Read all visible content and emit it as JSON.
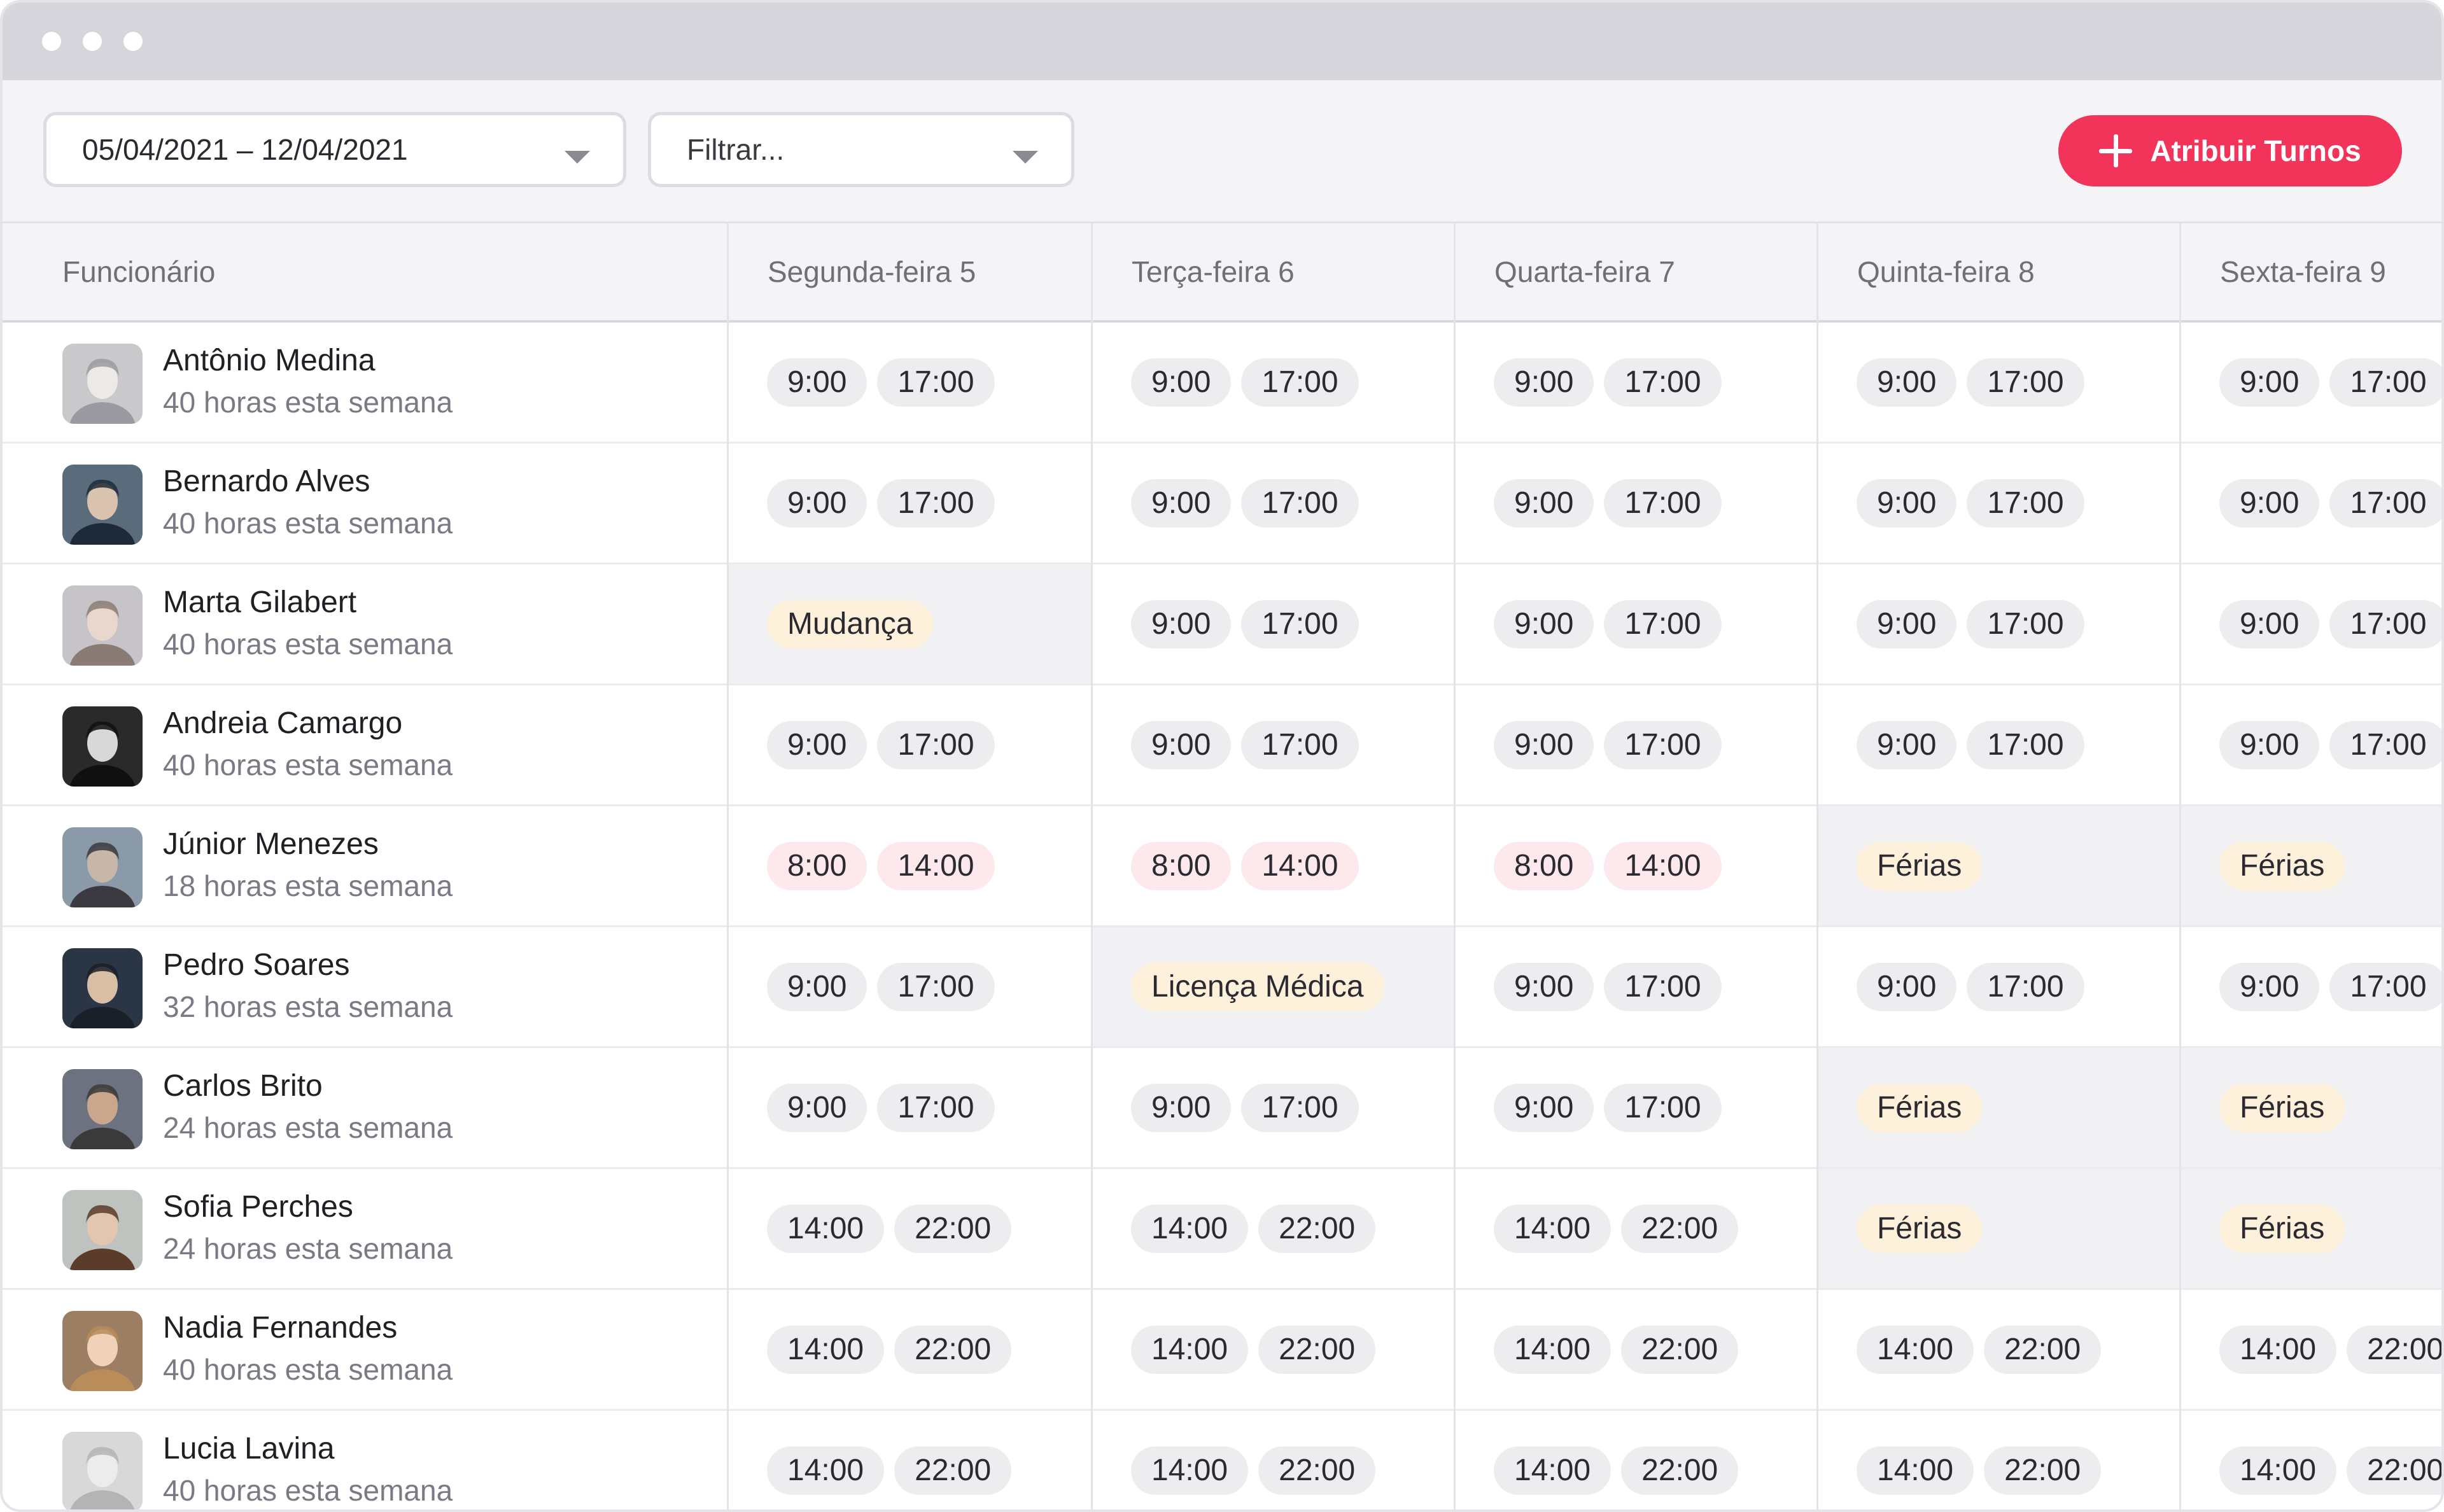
{
  "window": {
    "titlebar_color": "#d6d6dc"
  },
  "toolbar": {
    "date_range": "05/04/2021 – 12/04/2021",
    "filter_placeholder": "Filtrar...",
    "assign_button_label": "Atribuir Turnos",
    "accent_color": "#f2345b"
  },
  "table": {
    "headers": [
      "Funcionário",
      "Segunda-feira 5",
      "Terça-feira 6",
      "Quarta-feira 7",
      "Quinta-feira 8",
      "Sexta-feira 9"
    ],
    "rows": [
      {
        "name": "Antônio Medina",
        "hours": "40 horas esta semana",
        "avatar": "person-avatar",
        "days": [
          {
            "type": "shift",
            "start": "9:00",
            "end": "17:00"
          },
          {
            "type": "shift",
            "start": "9:00",
            "end": "17:00"
          },
          {
            "type": "shift",
            "start": "9:00",
            "end": "17:00"
          },
          {
            "type": "shift",
            "start": "9:00",
            "end": "17:00"
          },
          {
            "type": "shift",
            "start": "9:00",
            "end": "17:00"
          }
        ]
      },
      {
        "name": "Bernardo Alves",
        "hours": "40 horas esta semana",
        "avatar": "person-avatar",
        "days": [
          {
            "type": "shift",
            "start": "9:00",
            "end": "17:00"
          },
          {
            "type": "shift",
            "start": "9:00",
            "end": "17:00"
          },
          {
            "type": "shift",
            "start": "9:00",
            "end": "17:00"
          },
          {
            "type": "shift",
            "start": "9:00",
            "end": "17:00"
          },
          {
            "type": "shift",
            "start": "9:00",
            "end": "17:00"
          }
        ]
      },
      {
        "name": "Marta Gilabert",
        "hours": "40 horas esta semana",
        "avatar": "person-avatar",
        "days": [
          {
            "type": "absence",
            "label": "Mudança"
          },
          {
            "type": "shift",
            "start": "9:00",
            "end": "17:00"
          },
          {
            "type": "shift",
            "start": "9:00",
            "end": "17:00"
          },
          {
            "type": "shift",
            "start": "9:00",
            "end": "17:00"
          },
          {
            "type": "shift",
            "start": "9:00",
            "end": "17:00"
          }
        ]
      },
      {
        "name": "Andreia Camargo",
        "hours": "40 horas esta semana",
        "avatar": "person-avatar",
        "days": [
          {
            "type": "shift",
            "start": "9:00",
            "end": "17:00"
          },
          {
            "type": "shift",
            "start": "9:00",
            "end": "17:00"
          },
          {
            "type": "shift",
            "start": "9:00",
            "end": "17:00"
          },
          {
            "type": "shift",
            "start": "9:00",
            "end": "17:00"
          },
          {
            "type": "shift",
            "start": "9:00",
            "end": "17:00"
          }
        ]
      },
      {
        "name": "Júnior Menezes",
        "hours": "18 horas esta semana",
        "avatar": "person-avatar",
        "days": [
          {
            "type": "shift",
            "start": "8:00",
            "end": "14:00",
            "style": "pink"
          },
          {
            "type": "shift",
            "start": "8:00",
            "end": "14:00",
            "style": "pink"
          },
          {
            "type": "shift",
            "start": "8:00",
            "end": "14:00",
            "style": "pink"
          },
          {
            "type": "absence",
            "label": "Férias"
          },
          {
            "type": "absence",
            "label": "Férias"
          }
        ]
      },
      {
        "name": "Pedro Soares",
        "hours": "32 horas esta semana",
        "avatar": "person-avatar",
        "days": [
          {
            "type": "shift",
            "start": "9:00",
            "end": "17:00"
          },
          {
            "type": "absence",
            "label": "Licença Médica"
          },
          {
            "type": "shift",
            "start": "9:00",
            "end": "17:00"
          },
          {
            "type": "shift",
            "start": "9:00",
            "end": "17:00"
          },
          {
            "type": "shift",
            "start": "9:00",
            "end": "17:00"
          }
        ]
      },
      {
        "name": "Carlos Brito",
        "hours": "24 horas esta semana",
        "avatar": "person-avatar",
        "days": [
          {
            "type": "shift",
            "start": "9:00",
            "end": "17:00"
          },
          {
            "type": "shift",
            "start": "9:00",
            "end": "17:00"
          },
          {
            "type": "shift",
            "start": "9:00",
            "end": "17:00"
          },
          {
            "type": "absence",
            "label": "Férias"
          },
          {
            "type": "absence",
            "label": "Férias"
          }
        ]
      },
      {
        "name": "Sofia Perches",
        "hours": "24 horas esta semana",
        "avatar": "person-avatar",
        "days": [
          {
            "type": "shift",
            "start": "14:00",
            "end": "22:00"
          },
          {
            "type": "shift",
            "start": "14:00",
            "end": "22:00"
          },
          {
            "type": "shift",
            "start": "14:00",
            "end": "22:00"
          },
          {
            "type": "absence",
            "label": "Férias"
          },
          {
            "type": "absence",
            "label": "Férias"
          }
        ]
      },
      {
        "name": "Nadia Fernandes",
        "hours": "40 horas esta semana",
        "avatar": "person-avatar",
        "days": [
          {
            "type": "shift",
            "start": "14:00",
            "end": "22:00"
          },
          {
            "type": "shift",
            "start": "14:00",
            "end": "22:00"
          },
          {
            "type": "shift",
            "start": "14:00",
            "end": "22:00"
          },
          {
            "type": "shift",
            "start": "14:00",
            "end": "22:00"
          },
          {
            "type": "shift",
            "start": "14:00",
            "end": "22:00"
          }
        ]
      },
      {
        "name": "Lucia Lavina",
        "hours": "40 horas esta semana",
        "avatar": "person-avatar",
        "days": [
          {
            "type": "shift",
            "start": "14:00",
            "end": "22:00"
          },
          {
            "type": "shift",
            "start": "14:00",
            "end": "22:00"
          },
          {
            "type": "shift",
            "start": "14:00",
            "end": "22:00"
          },
          {
            "type": "shift",
            "start": "14:00",
            "end": "22:00"
          },
          {
            "type": "shift",
            "start": "14:00",
            "end": "22:00"
          }
        ]
      }
    ]
  }
}
